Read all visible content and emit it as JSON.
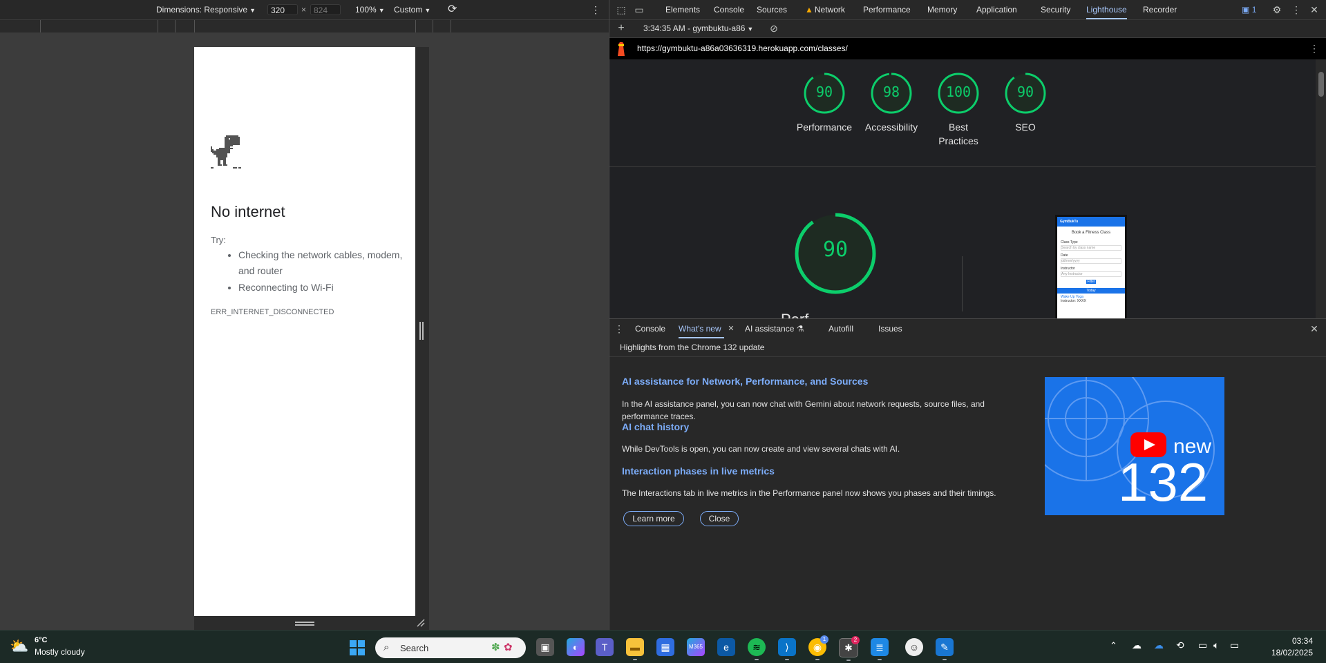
{
  "device_toolbar": {
    "dimensions_label": "Dimensions: Responsive",
    "width": "320",
    "height_placeholder": "824",
    "zoom": "100%",
    "throttle": "Custom"
  },
  "page": {
    "title": "No internet",
    "try_label": "Try:",
    "suggestions": [
      "Checking the network cables, modem, and router",
      "Reconnecting to Wi-Fi"
    ],
    "error_code": "ERR_INTERNET_DISCONNECTED"
  },
  "devtools": {
    "tabs": [
      "Elements",
      "Console",
      "Sources",
      "Network",
      "Performance",
      "Memory",
      "Application",
      "Security",
      "Lighthouse",
      "Recorder"
    ],
    "active_tab": "Lighthouse",
    "issues_count": "1",
    "lighthouse": {
      "report_label": "3:34:35 AM - gymbuktu-a86",
      "url": "https://gymbuktu-a86a03636319.herokuapp.com/classes/",
      "scores": [
        {
          "label": "Performance",
          "score": 90
        },
        {
          "label": "Accessibility",
          "score": 98
        },
        {
          "label": "Best Practices",
          "score": 100
        },
        {
          "label": "SEO",
          "score": 90
        }
      ],
      "big_score": 90,
      "big_label": "Perf",
      "thumb": {
        "brand": "GymBukTu",
        "heading": "Book a Fitness Class",
        "f1": "Class Type",
        "f1v": "Search by class name",
        "f2": "Date",
        "f2v": "dd/mm/yyyy",
        "f3": "Instructor",
        "f3v": "Any Instructor",
        "button": "Filter",
        "today": "Today",
        "item": "Wake Up Yoga",
        "item2": "Instructor: XXXX"
      }
    }
  },
  "drawer": {
    "tabs": [
      "Console",
      "What's new",
      "AI assistance",
      "Autofill",
      "Issues"
    ],
    "active_tab": "What's new",
    "highlights": "Highlights from the Chrome 132 update",
    "sections": [
      {
        "title": "AI assistance for Network, Performance, and Sources",
        "body": "In the AI assistance panel, you can now chat with Gemini about network requests, source files, and performance traces."
      },
      {
        "title": "AI chat history",
        "body": "While DevTools is open, you can now create and view several chats with AI."
      },
      {
        "title": "Interaction phases in live metrics",
        "body": "The Interactions tab in live metrics in the Performance panel now shows you phases and their timings."
      }
    ],
    "learn_more": "Learn more",
    "close": "Close",
    "video_new": "new",
    "video_version": "132"
  },
  "taskbar": {
    "weather_temp": "6°C",
    "weather_desc": "Mostly cloudy",
    "search_placeholder": "Search",
    "time": "03:34",
    "date": "18/02/2025",
    "copilot_label": "M365",
    "chrome_badge": "2",
    "focus_badge": "1"
  },
  "colors": {
    "score_green": "#0cce6b",
    "accent_blue": "#a8c7fa",
    "link_blue": "#7cacf8"
  }
}
